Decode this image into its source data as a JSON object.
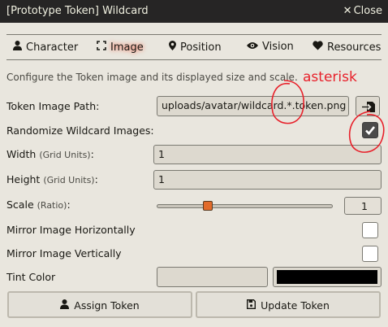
{
  "window": {
    "title": "[Prototype Token] Wildcard",
    "close_label": "Close"
  },
  "tabs": [
    {
      "label": "Character",
      "icon": "user-icon",
      "active": false
    },
    {
      "label": "Image",
      "icon": "expand-icon",
      "active": true
    },
    {
      "label": "Position",
      "icon": "map-marker-icon",
      "active": false
    },
    {
      "label": "Vision",
      "icon": "eye-icon",
      "active": false
    },
    {
      "label": "Resources",
      "icon": "heart-icon",
      "active": false
    }
  ],
  "hint": "Configure the Token image and its displayed size and scale.",
  "annotation": {
    "text": "asterisk",
    "color": "#e8202a"
  },
  "form": {
    "image_path": {
      "label": "Token Image Path:",
      "value": "uploads/avatar/wildcard.*.token.png"
    },
    "randomize": {
      "label": "Randomize Wildcard Images:",
      "checked": true
    },
    "width": {
      "label": "Width",
      "unit": "(Grid Units)",
      "colon": ":",
      "value": "1"
    },
    "height": {
      "label": "Height",
      "unit": "(Grid Units)",
      "colon": ":",
      "value": "1"
    },
    "scale": {
      "label": "Scale",
      "unit": "(Ratio)",
      "colon": ":",
      "value": "1",
      "fraction": 0.29
    },
    "mirror_h": {
      "label": "Mirror Image Horizontally",
      "checked": false
    },
    "mirror_v": {
      "label": "Mirror Image Vertically",
      "checked": false
    },
    "tint": {
      "label": "Tint Color",
      "value": "",
      "color": "#000000"
    }
  },
  "footer": {
    "assign_label": "Assign Token",
    "update_label": "Update Token"
  },
  "colors": {
    "background": "#e9e6de",
    "titlebar": "#262525",
    "accent": "#e26b2b",
    "active_glow": "#ff4d2e"
  }
}
